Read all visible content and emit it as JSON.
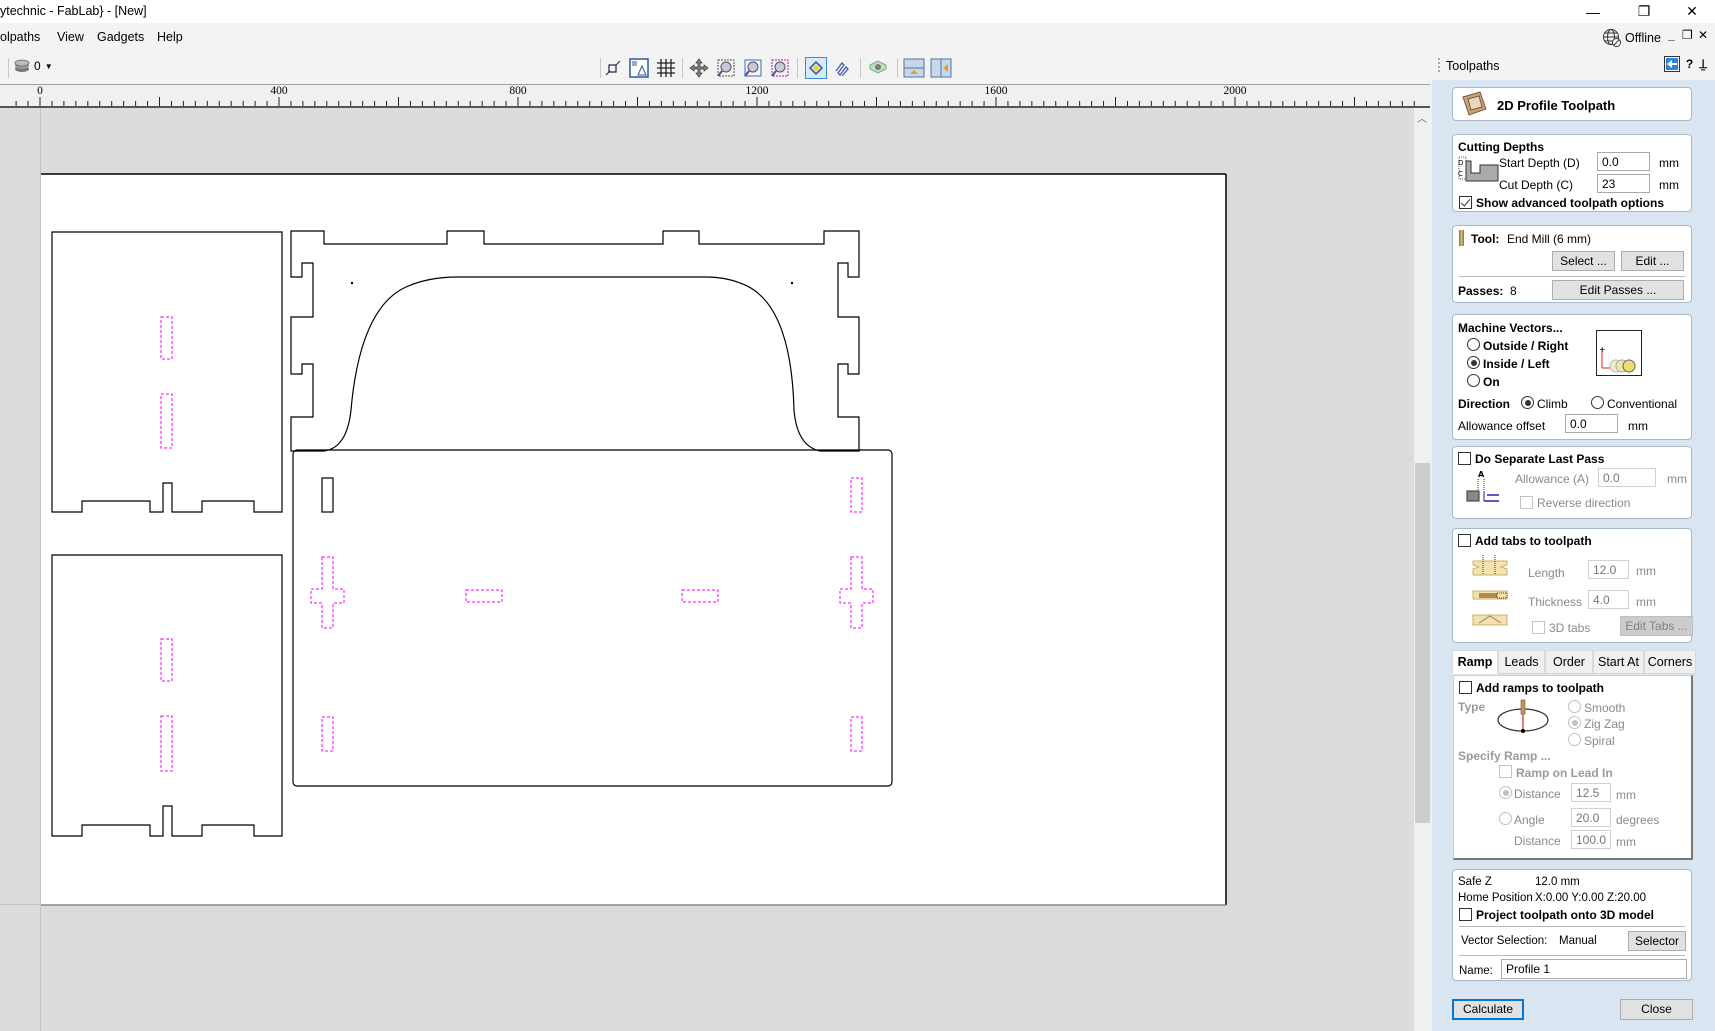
{
  "window": {
    "title": "ytechnic - FabLab} - [New]",
    "controls": {
      "minimize": "—",
      "restore": "❐",
      "close": "✕"
    }
  },
  "menu": {
    "items": [
      "olpaths",
      "View",
      "Gadgets",
      "Help"
    ],
    "status": "Offline",
    "mdi_controls": {
      "minimize": "_",
      "restore": "❐",
      "close": "✕"
    }
  },
  "toolbar": {
    "layer_value": "0",
    "buttons": [
      "snap-to-grid",
      "show-document-dimensions",
      "grid",
      "pan",
      "zoom-box",
      "zoom-to-fit",
      "zoom-selected",
      "toggle-vector-view",
      "toggle-toolpath-view",
      "toggle-3d-view",
      "layout-tile-horizontal",
      "layout-tile-vertical"
    ],
    "active_button": "toggle-vector-view"
  },
  "ruler": {
    "labels": [
      "0",
      "400",
      "800",
      "1200",
      "1600",
      "2000"
    ]
  },
  "panel": {
    "title": "Toolpaths",
    "header_icons": {
      "help": "?",
      "pin": "⊥"
    },
    "toolpath_name": "2D Profile Toolpath",
    "cutting_depths": {
      "heading": "Cutting Depths",
      "start_depth_label": "Start Depth (D)",
      "start_depth_value": "0.0",
      "cut_depth_label": "Cut Depth (C)",
      "cut_depth_value": "23",
      "unit": "mm",
      "advanced_label": "Show advanced toolpath options",
      "advanced_checked": true
    },
    "tool": {
      "label": "Tool:",
      "value": "End Mill (6 mm)",
      "select_button": "Select ...",
      "edit_button": "Edit ...",
      "passes_label": "Passes:",
      "passes_value": "8",
      "edit_passes_button": "Edit Passes ..."
    },
    "machine_vectors": {
      "heading": "Machine Vectors...",
      "options": [
        "Outside / Right",
        "Inside / Left",
        "On"
      ],
      "selected": "Inside / Left",
      "direction_label": "Direction",
      "direction_options": [
        "Climb",
        "Conventional"
      ],
      "direction_selected": "Climb",
      "allowance_label": "Allowance offset",
      "allowance_value": "0.0",
      "unit": "mm"
    },
    "last_pass": {
      "label": "Do Separate Last Pass",
      "checked": false,
      "allowance_label": "Allowance (A)",
      "allowance_value": "0.0",
      "unit": "mm",
      "reverse_label": "Reverse direction"
    },
    "tabs": {
      "label": "Add tabs to toolpath",
      "checked": false,
      "length_label": "Length",
      "length_value": "12.0",
      "thickness_label": "Thickness",
      "thickness_value": "4.0",
      "unit": "mm",
      "tabs3d_label": "3D tabs",
      "edit_tabs_button": "Edit Tabs ..."
    },
    "options_tabs": {
      "labels": [
        "Ramp",
        "Leads",
        "Order",
        "Start At",
        "Corners"
      ],
      "active": "Ramp"
    },
    "ramp": {
      "label": "Add ramps to toolpath",
      "checked": false,
      "type_label": "Type",
      "type_options": [
        "Smooth",
        "Zig Zag",
        "Spiral"
      ],
      "type_selected": "Zig Zag",
      "specify_label": "Specify Ramp ...",
      "lead_in_label": "Ramp on Lead In",
      "distance_label": "Distance",
      "distance_value": "12.5",
      "angle_label": "Angle",
      "angle_value": "20.0",
      "angle_unit": "degrees",
      "angle_distance_label": "Distance",
      "angle_distance_value": "100.0",
      "unit": "mm",
      "mode_selected": "Distance"
    },
    "footer": {
      "safe_z_label": "Safe Z",
      "safe_z_value": "12.0 mm",
      "home_label": "Home Position",
      "home_value": "X:0.00 Y:0.00 Z:20.00",
      "project_label": "Project toolpath onto 3D model",
      "vector_selection_label": "Vector Selection:",
      "vector_selection_value": "Manual",
      "selector_button": "Selector ...",
      "name_label": "Name:",
      "name_value": "Profile 1"
    },
    "calculate_button": "Calculate",
    "close_button": "Close"
  },
  "colors": {
    "panel_bg": "#d9e5f1",
    "workspace_bg": "#dcdcdc",
    "vector_line": "#000000",
    "selected_vector": "#ff00ff",
    "accent": "#0078d7"
  }
}
